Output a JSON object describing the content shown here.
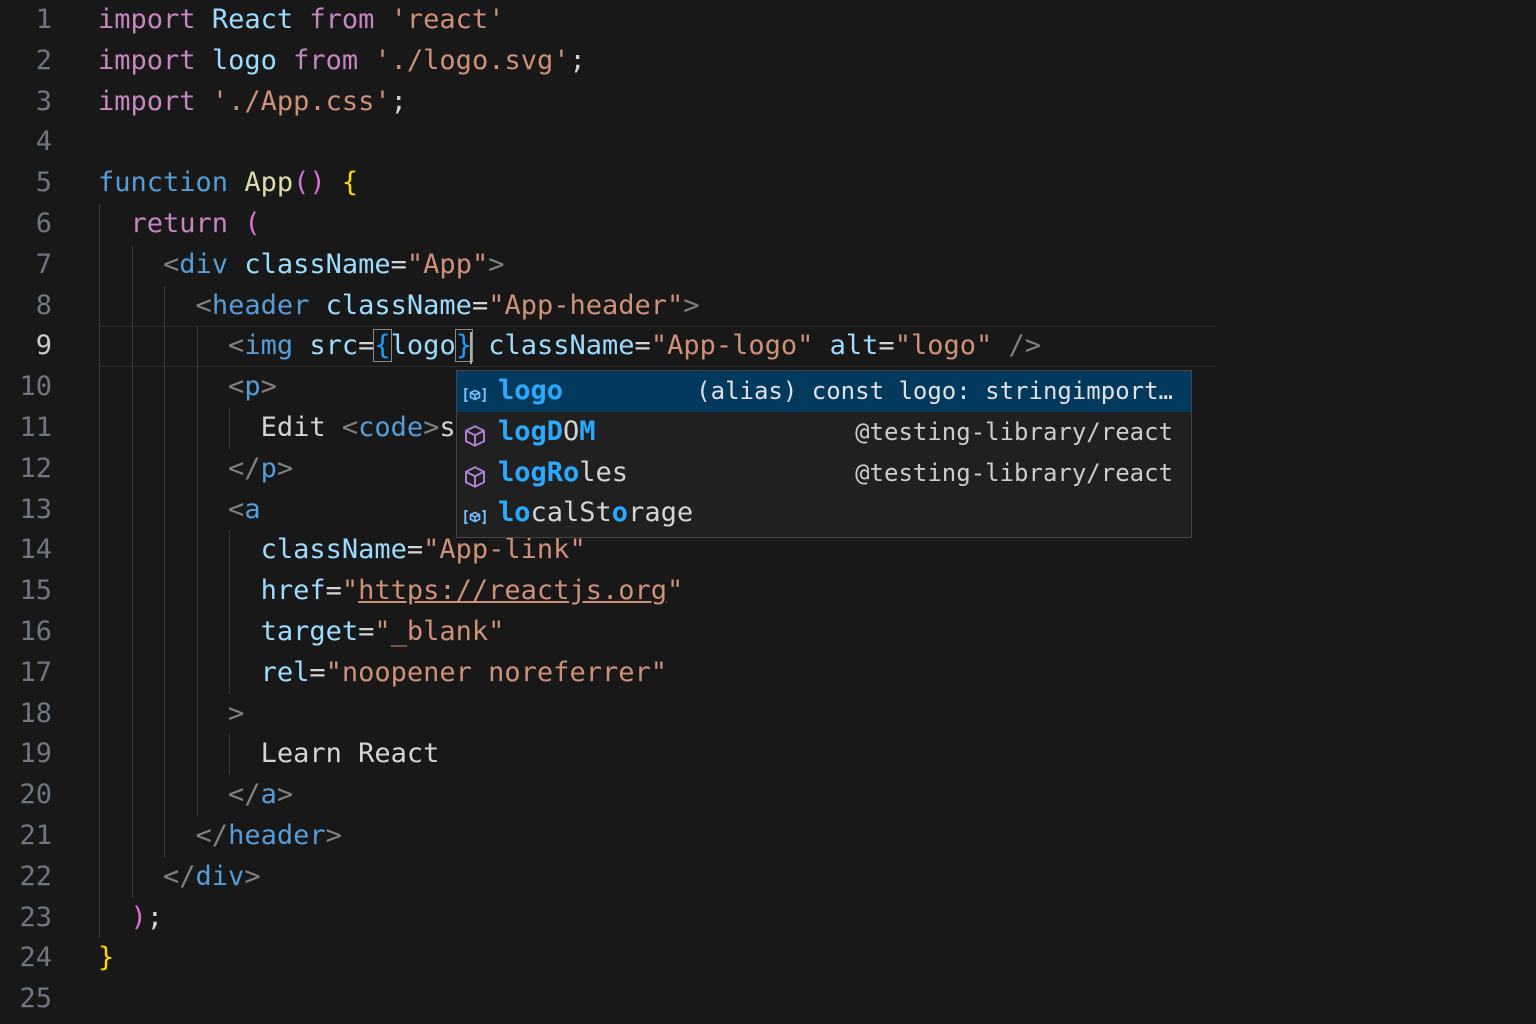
{
  "editor": {
    "language": "jsx",
    "current_line": 9,
    "lines": [
      {
        "n": "1",
        "tokens": [
          [
            "kw",
            "import"
          ],
          [
            "txt",
            " "
          ],
          [
            "var",
            "React"
          ],
          [
            "txt",
            " "
          ],
          [
            "kw",
            "from"
          ],
          [
            "txt",
            " "
          ],
          [
            "str",
            "'react'"
          ]
        ]
      },
      {
        "n": "2",
        "tokens": [
          [
            "kw",
            "import"
          ],
          [
            "txt",
            " "
          ],
          [
            "var",
            "logo"
          ],
          [
            "txt",
            " "
          ],
          [
            "kw",
            "from"
          ],
          [
            "txt",
            " "
          ],
          [
            "str",
            "'./logo.svg'"
          ],
          [
            "txt",
            ";"
          ]
        ]
      },
      {
        "n": "3",
        "tokens": [
          [
            "kw",
            "import"
          ],
          [
            "txt",
            " "
          ],
          [
            "str",
            "'./App.css'"
          ],
          [
            "txt",
            ";"
          ]
        ]
      },
      {
        "n": "4",
        "tokens": []
      },
      {
        "n": "5",
        "tokens": [
          [
            "kwb",
            "function"
          ],
          [
            "txt",
            " "
          ],
          [
            "fn",
            "App"
          ],
          [
            "b2",
            "()"
          ],
          [
            "txt",
            " "
          ],
          [
            "b1",
            "{"
          ]
        ]
      },
      {
        "n": "6",
        "tokens": [
          [
            "txt",
            "  "
          ],
          [
            "kw",
            "return"
          ],
          [
            "txt",
            " "
          ],
          [
            "b2",
            "("
          ]
        ]
      },
      {
        "n": "7",
        "tokens": [
          [
            "txt",
            "    "
          ],
          [
            "ang",
            "<"
          ],
          [
            "tag",
            "div"
          ],
          [
            "txt",
            " "
          ],
          [
            "attr",
            "className"
          ],
          [
            "txt",
            "="
          ],
          [
            "str",
            "\"App\""
          ],
          [
            "ang",
            ">"
          ]
        ]
      },
      {
        "n": "8",
        "tokens": [
          [
            "txt",
            "      "
          ],
          [
            "ang",
            "<"
          ],
          [
            "tag",
            "header"
          ],
          [
            "txt",
            " "
          ],
          [
            "attr",
            "className"
          ],
          [
            "txt",
            "="
          ],
          [
            "str",
            "\"App-header\""
          ],
          [
            "ang",
            ">"
          ]
        ]
      },
      {
        "n": "9",
        "tokens": [
          [
            "txt",
            "        "
          ],
          [
            "ang",
            "<"
          ],
          [
            "tag",
            "img"
          ],
          [
            "txt",
            " "
          ],
          [
            "attr",
            "src"
          ],
          [
            "txt",
            "="
          ],
          [
            "b3bm",
            "{"
          ],
          [
            "var",
            "logo"
          ],
          [
            "b3bm",
            "}"
          ],
          [
            "txt",
            " "
          ],
          [
            "attr",
            "className"
          ],
          [
            "txt",
            "="
          ],
          [
            "str",
            "\"App-logo\""
          ],
          [
            "txt",
            " "
          ],
          [
            "attr",
            "alt"
          ],
          [
            "txt",
            "="
          ],
          [
            "str",
            "\"logo\""
          ],
          [
            "txt",
            " "
          ],
          [
            "ang",
            "/>"
          ]
        ]
      },
      {
        "n": "10",
        "tokens": [
          [
            "txt",
            "        "
          ],
          [
            "ang",
            "<"
          ],
          [
            "tag",
            "p"
          ],
          [
            "ang",
            ">"
          ]
        ]
      },
      {
        "n": "11",
        "tokens": [
          [
            "txt",
            "          "
          ],
          [
            "txt",
            "Edit "
          ],
          [
            "ang",
            "<"
          ],
          [
            "tag",
            "code"
          ],
          [
            "ang",
            ">"
          ],
          [
            "txt",
            "s"
          ]
        ]
      },
      {
        "n": "12",
        "tokens": [
          [
            "txt",
            "        "
          ],
          [
            "ang",
            "</"
          ],
          [
            "tag",
            "p"
          ],
          [
            "ang",
            ">"
          ]
        ]
      },
      {
        "n": "13",
        "tokens": [
          [
            "txt",
            "        "
          ],
          [
            "ang",
            "<"
          ],
          [
            "tag",
            "a"
          ]
        ]
      },
      {
        "n": "14",
        "tokens": [
          [
            "txt",
            "          "
          ],
          [
            "attr",
            "className"
          ],
          [
            "txt",
            "="
          ],
          [
            "str",
            "\"App-link\""
          ]
        ]
      },
      {
        "n": "15",
        "tokens": [
          [
            "txt",
            "          "
          ],
          [
            "attr",
            "href"
          ],
          [
            "txt",
            "="
          ],
          [
            "str",
            "\""
          ],
          [
            "url",
            "https://reactjs.org"
          ],
          [
            "str",
            "\""
          ]
        ]
      },
      {
        "n": "16",
        "tokens": [
          [
            "txt",
            "          "
          ],
          [
            "attr",
            "target"
          ],
          [
            "txt",
            "="
          ],
          [
            "str",
            "\"_blank\""
          ]
        ]
      },
      {
        "n": "17",
        "tokens": [
          [
            "txt",
            "          "
          ],
          [
            "attr",
            "rel"
          ],
          [
            "txt",
            "="
          ],
          [
            "str",
            "\"noopener noreferrer\""
          ]
        ]
      },
      {
        "n": "18",
        "tokens": [
          [
            "txt",
            "        "
          ],
          [
            "ang",
            ">"
          ]
        ]
      },
      {
        "n": "19",
        "tokens": [
          [
            "txt",
            "          "
          ],
          [
            "txt",
            "Learn React"
          ]
        ]
      },
      {
        "n": "20",
        "tokens": [
          [
            "txt",
            "        "
          ],
          [
            "ang",
            "</"
          ],
          [
            "tag",
            "a"
          ],
          [
            "ang",
            ">"
          ]
        ]
      },
      {
        "n": "21",
        "tokens": [
          [
            "txt",
            "      "
          ],
          [
            "ang",
            "</"
          ],
          [
            "tag",
            "header"
          ],
          [
            "ang",
            ">"
          ]
        ]
      },
      {
        "n": "22",
        "tokens": [
          [
            "txt",
            "    "
          ],
          [
            "ang",
            "</"
          ],
          [
            "tag",
            "div"
          ],
          [
            "ang",
            ">"
          ]
        ]
      },
      {
        "n": "23",
        "tokens": [
          [
            "txt",
            "  "
          ],
          [
            "b2",
            ")"
          ],
          [
            "txt",
            ";"
          ]
        ]
      },
      {
        "n": "24",
        "tokens": [
          [
            "b1",
            "}"
          ]
        ]
      },
      {
        "n": "25",
        "tokens": []
      }
    ]
  },
  "suggest": {
    "items": [
      {
        "hl": "logo",
        "rest": [],
        "detail": "(alias) const logo: stringimport…",
        "icon": "variable-icon",
        "selected": true
      },
      {
        "hl": "logD",
        "rest": [
          [
            "n",
            "O"
          ],
          [
            "h",
            "M"
          ]
        ],
        "detail": "@testing-library/react",
        "icon": "module-icon",
        "selected": false
      },
      {
        "hl": "logR",
        "rest": [
          [
            "h",
            "o"
          ],
          [
            "n",
            "les"
          ]
        ],
        "detail": "@testing-library/react",
        "icon": "module-icon",
        "selected": false
      },
      {
        "hl": "lo",
        "rest": [
          [
            "n",
            "calSt"
          ],
          [
            "h",
            "o"
          ],
          [
            "n",
            "rage"
          ]
        ],
        "detail": "",
        "icon": "variable-icon",
        "selected": false
      }
    ]
  },
  "colors": {
    "background": "#181818",
    "selection": "#04395e",
    "match_highlight": "#2aaaff"
  }
}
